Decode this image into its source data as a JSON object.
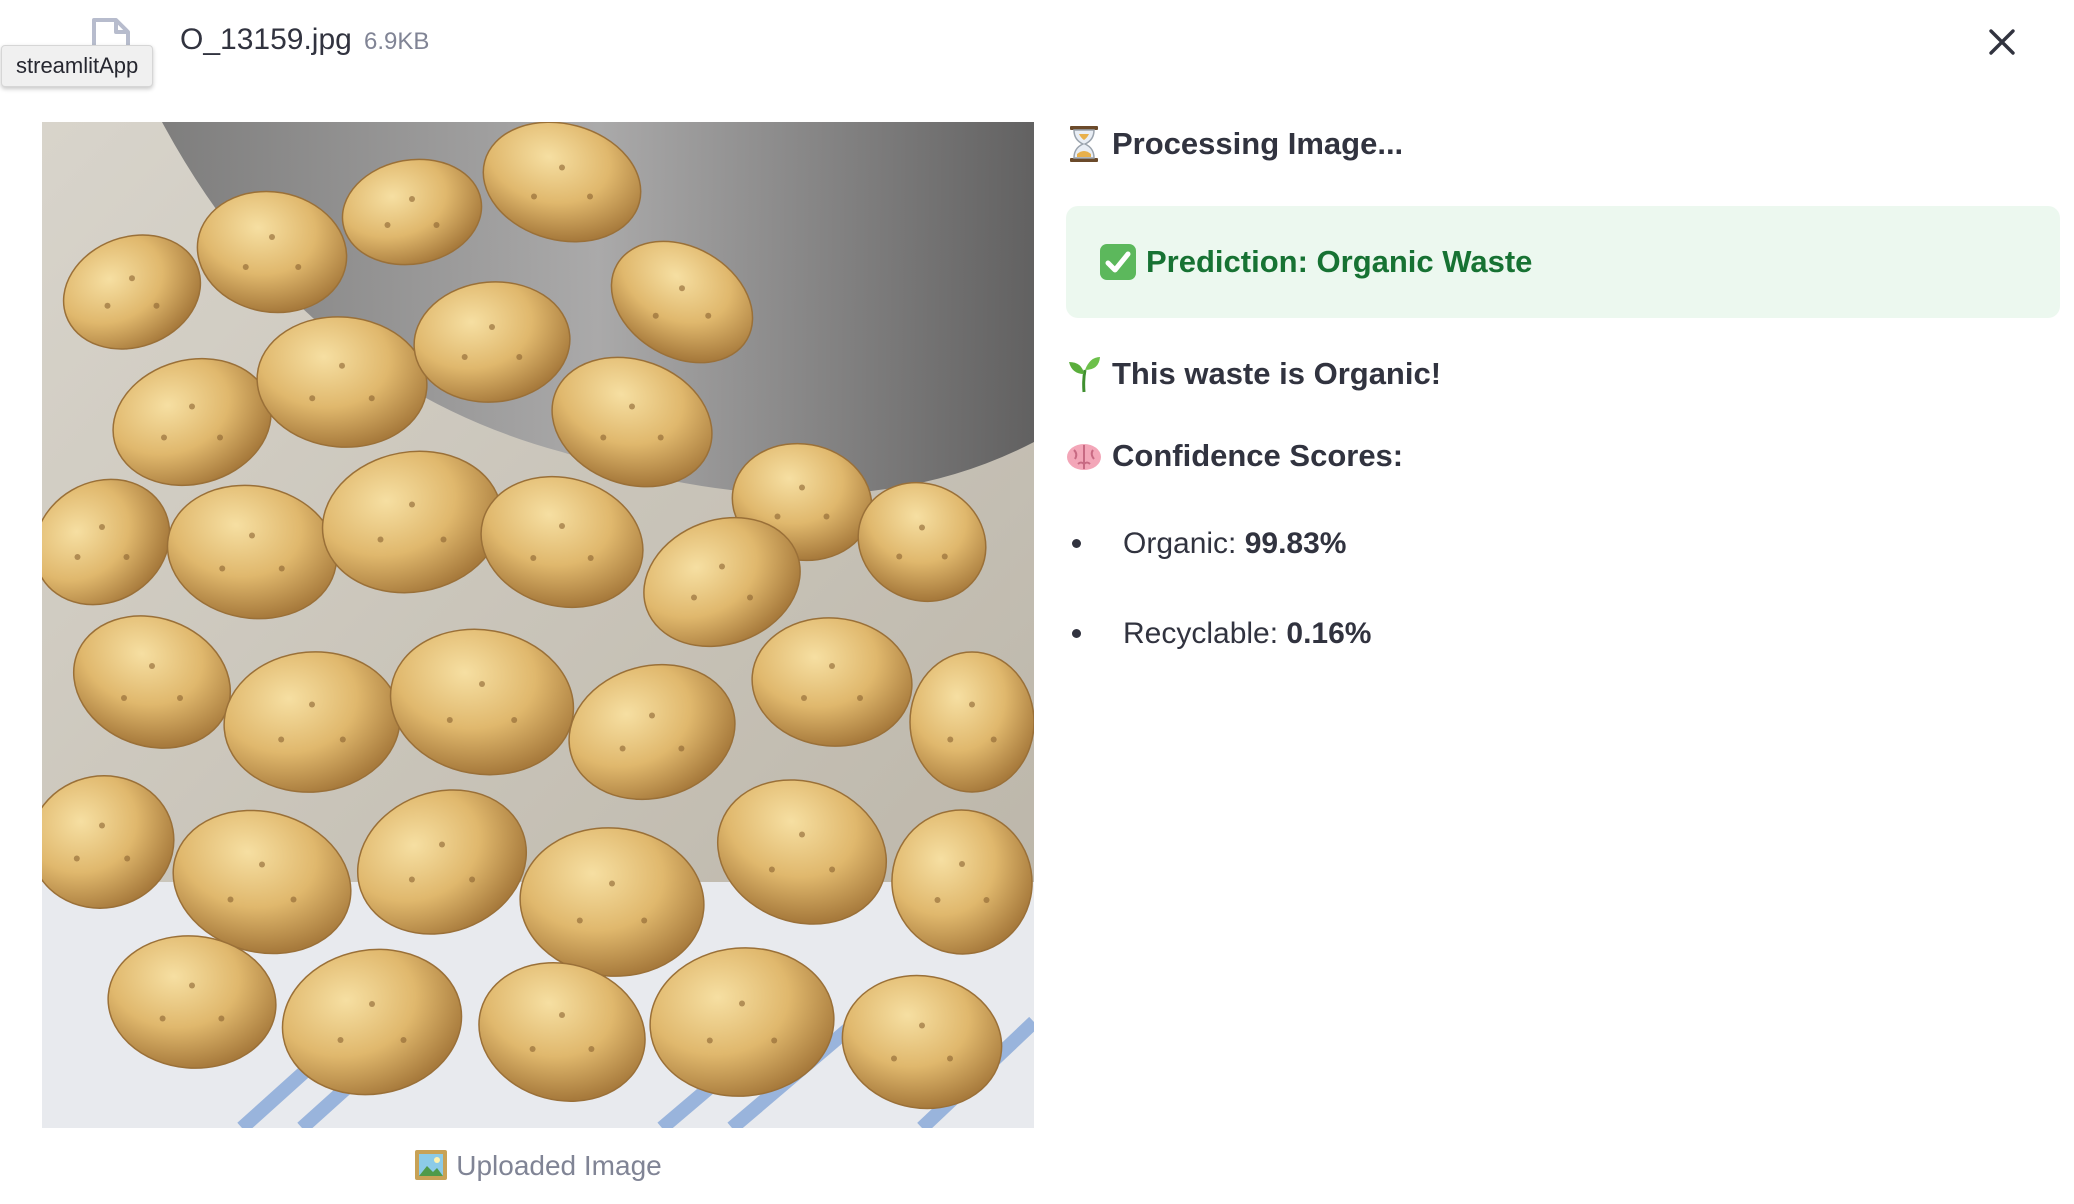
{
  "file": {
    "name": "O_13159.jpg",
    "size": "6.9KB",
    "icon": "file-icon",
    "tooltip": "streamlitApp",
    "close_icon": "close-icon"
  },
  "image": {
    "caption": "Uploaded Image",
    "caption_icon": "framed-picture-emoji"
  },
  "results": {
    "processing": {
      "icon": "hourglass-emoji",
      "text": "Processing Image..."
    },
    "prediction": {
      "icon": "check-mark-button-emoji",
      "text": "Prediction: Organic Waste"
    },
    "verdict": {
      "icon": "seedling-emoji",
      "text": "This waste is Organic!"
    },
    "confidence": {
      "icon": "brain-emoji",
      "title": "Confidence Scores:",
      "items": [
        {
          "label": "Organic: ",
          "value": "99.83%"
        },
        {
          "label": "Recyclable: ",
          "value": "0.16%"
        }
      ]
    }
  },
  "colors": {
    "success_bg": "#ecf8ef",
    "success_text": "#177233",
    "text": "#31333f",
    "muted": "#808495"
  }
}
